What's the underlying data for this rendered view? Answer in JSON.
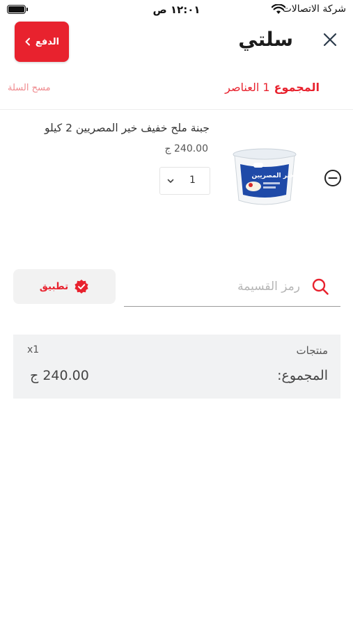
{
  "status_bar": {
    "carrier": "شركة الاتصالات",
    "time": "١٢:٠١ ص"
  },
  "header": {
    "title": "سلتي",
    "pay_label": "الدفع"
  },
  "summary": {
    "total_label": "المجموع",
    "items_count": "1 العناصر",
    "clear_cart": "مسح السلة"
  },
  "cart": {
    "items": [
      {
        "name": "جبنة ملح خفيف خير المصريين 2 كيلو",
        "price": "240.00 ج",
        "quantity": "1",
        "image_icon": "cheese-tub-image",
        "image_brand_text": "خير المصريين"
      }
    ]
  },
  "coupon": {
    "placeholder": "رمز القسيمة",
    "value": "",
    "apply_label": "تطبيق"
  },
  "totals": {
    "products_label": "منتجات",
    "products_count": "x1",
    "total_label": "المجموع:",
    "total_value": "240.00 ج"
  },
  "colors": {
    "accent": "#e8222e",
    "accent_light": "#ef8a8e",
    "panel_bg": "#f1f2f3"
  }
}
